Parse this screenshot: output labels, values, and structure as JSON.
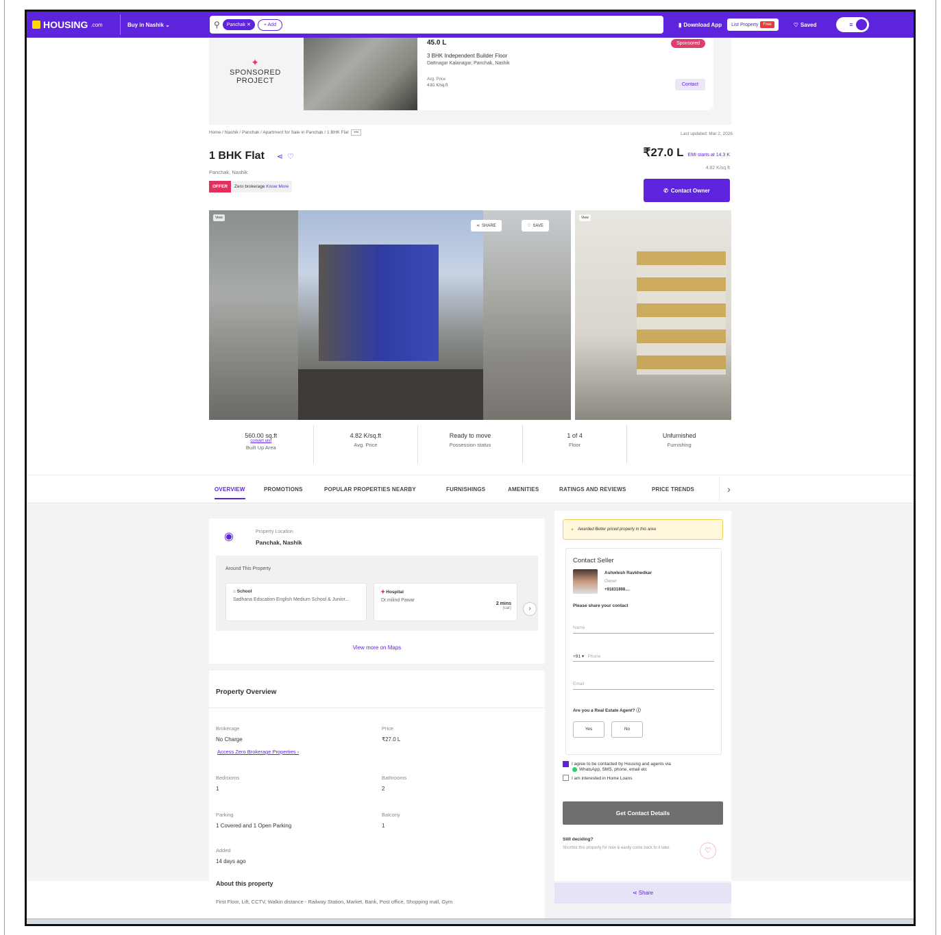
{
  "nav": {
    "brand": "HOUSING",
    "brand_suffix": ".com",
    "buy_in": "Buy in Nashik",
    "search_chip": "Panchak",
    "search_add": "+ Add",
    "download_app": "Download App",
    "list_property": "List Property",
    "free_badge": "Free",
    "saved": "Saved"
  },
  "sponsored": {
    "label_line1": "SPONSORED",
    "label_line2": "PROJECT",
    "price": "45.0 L",
    "type": "3 BHK Independent Builder Floor",
    "location": "Dattnagar Kalanagar, Panchak, Nashik",
    "avg_label": "Avg. Price",
    "avg_value": "4.81 K/sq.ft",
    "badge": "Sponsored",
    "contact": "Contact"
  },
  "listing": {
    "breadcrumb": "Home / Nashik / Panchak / Apartment for Sale in Panchak / 1 BHK Flat",
    "breadcrumb_more": "•••",
    "updated": "Last updated: Mar 2, 2026",
    "title": "1 BHK Flat",
    "locality": "Panchak, Nashik",
    "offer_tag": "OFFER",
    "offer_text": "Zero brokerage",
    "offer_link": "Know More",
    "price": "₹27.0 L",
    "emi": "EMI starts at 14.3 K",
    "price_sqft": "4.82 K/sq.ft",
    "contact_owner": "Contact Owner"
  },
  "gallery": {
    "tag_left": "View",
    "tag_right": "View",
    "share": "SHARE",
    "save": "SAVE"
  },
  "stats": [
    {
      "value": "560.00 sq.ft",
      "sub": "convert unit",
      "label": "Built Up Area"
    },
    {
      "value": "4.82 K/sq.ft",
      "label": "Avg. Price"
    },
    {
      "value": "Ready to move",
      "label": "Possession status"
    },
    {
      "value": "1 of 4",
      "label": "Floor"
    },
    {
      "value": "Unfurnished",
      "label": "Furnishing"
    }
  ],
  "tabs": [
    "OVERVIEW",
    "PROMOTIONS",
    "POPULAR PROPERTIES NEARBY",
    "FURNISHINGS",
    "AMENITIES",
    "RATINGS AND REVIEWS",
    "PRICE TRENDS"
  ],
  "location_card": {
    "label": "Property Location",
    "value": "Panchak, Nashik",
    "around": "Around This Property",
    "poi": [
      {
        "type": "School",
        "name": "Sadhana Education English Medium School & Junior..."
      },
      {
        "type": "Hospital",
        "name": "Dr.milind Pawar",
        "time": "2 mins",
        "mode": "(car)"
      }
    ],
    "view_more": "View more on Maps"
  },
  "overview": {
    "title": "Property Overview",
    "brokerage_k": "Brokerage",
    "brokerage_v": "No Charge",
    "brokerage_link": "Access Zero Brokerage Properties ›",
    "price_k": "Price",
    "price_v": "₹27.0 L",
    "bedrooms_k": "Bedrooms",
    "bedrooms_v": "1",
    "bathrooms_k": "Bathrooms",
    "bathrooms_v": "2",
    "parking_k": "Parking",
    "parking_v": "1 Covered and 1 Open Parking",
    "balcony_k": "Balcony",
    "balcony_v": "1",
    "added_k": "Added",
    "added_v": "14 days ago",
    "about_title": "About this property",
    "about_text": "First Floor, Lift, CCTV, Walkin distance - Railway Station, Market, Bank, Post office, Shopping mall, Gym"
  },
  "seller": {
    "awarded": "Awarded Better priced property in this area",
    "title": "Contact Seller",
    "name": "Ashwlesh Ravkhedkar",
    "role": "Owner",
    "phone": "+91831898....",
    "share_label": "Please share your contact",
    "name_ph": "Name",
    "code": "+91 ▾",
    "phone_ph": "Phone",
    "email_ph": "Email",
    "agent_q": "Are you a Real Estate Agent? ⓘ",
    "yes": "Yes",
    "no": "No",
    "consent1": "I agree to be contacted by Housing and agents via",
    "consent1b": "WhatsApp, SMS, phone, email etc",
    "consent2": "I am interested in Home Loans",
    "get_btn": "Get Contact Details",
    "deciding": "Still deciding?",
    "deciding_d": "Shortlist this property for now & easily come back to it later.",
    "share": "Share"
  }
}
